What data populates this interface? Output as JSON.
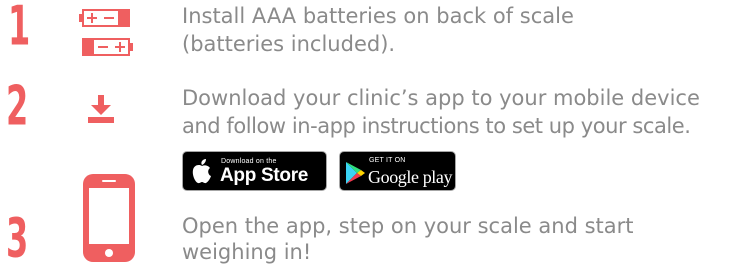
{
  "steps": [
    {
      "number": "1",
      "text_line1": "Install AAA batteries on back of scale",
      "text_line2": "(batteries included).",
      "icon": "batteries-icon"
    },
    {
      "number": "2",
      "text_line1": "Download your clinic’s app to your mobile device",
      "text_line2": "and follow in-app instructions to set up your scale.",
      "icon": "download-icon"
    },
    {
      "number": "3",
      "text_line1": "Open the app, step on your scale and start",
      "text_line2": "weighing in!",
      "icon": "mobile-phone-icon"
    }
  ],
  "badges": {
    "app_store": {
      "small_label": "Download on the",
      "big_label": "App Store",
      "icon": "apple-icon"
    },
    "google_play": {
      "small_label": "GET IT ON",
      "big_label": "Google play",
      "icon": "play-triangle-icon"
    }
  },
  "colors": {
    "accent": "#ef5f60",
    "text": "#8a8a8a",
    "badge_bg": "#000000"
  }
}
